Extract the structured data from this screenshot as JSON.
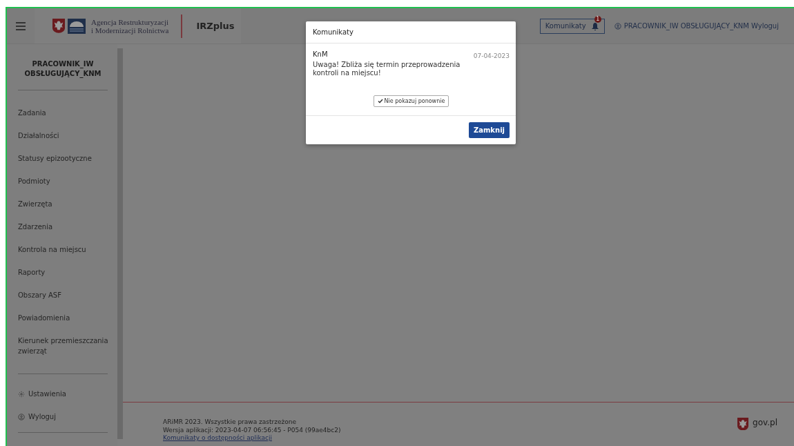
{
  "header": {
    "agency_name": [
      "Agencja Restrukturyzacji",
      "i Modernizacji Rolnictwa"
    ],
    "app_name": "IRZplus",
    "messages_button": {
      "label": "Komunikaty",
      "badge": "1"
    },
    "user_label": "PRACOWNIK_IW OBSŁUGUJĄCY_KNM",
    "logout": "Wyloguj"
  },
  "sidebar": {
    "user_name": "PRACOWNIK_IW OBSŁUGUJĄCY_KNM",
    "items": [
      "Zadania",
      "Działalności",
      "Statusy epizootyczne",
      "Podmioty",
      "Zwierzęta",
      "Zdarzenia",
      "Kontrola na miejscu",
      "Raporty",
      "Obszary ASF",
      "Powiadomienia",
      "Kierunek przemieszczania zwierząt"
    ],
    "bottom_items": [
      {
        "kind": "settings",
        "label": "Ustawienia"
      },
      {
        "kind": "user",
        "label": "Wyloguj"
      }
    ]
  },
  "footer": {
    "copyright": "ARiMR 2023. Wszystkie prawa zastrzeżone",
    "version": "Wersja aplikacji: 2023-04-07 06:56:45 - P054 (99ae4bc2)",
    "link": "Komunikaty o dostępności aplikacji",
    "gov_label": "gov.pl"
  },
  "modal": {
    "title": "Komunikaty",
    "messages": [
      {
        "sender": "KnM",
        "date": "07-04-2023",
        "text": "Uwaga! Zbliża się termin przeprowadzenia kontroli na miejscu!"
      }
    ],
    "dont_show_button": "Nie pokazuj ponownie",
    "close_button": "Zamknij"
  }
}
